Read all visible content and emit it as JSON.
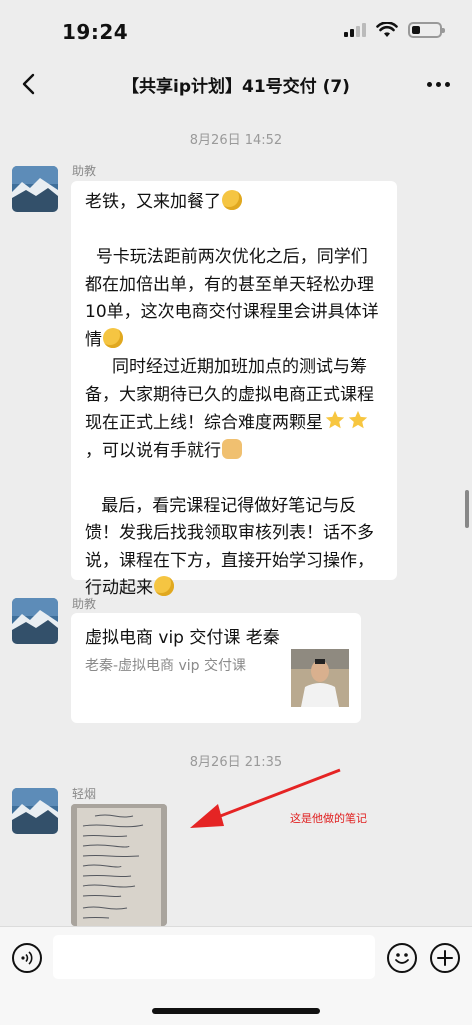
{
  "status_bar": {
    "time": "19:24"
  },
  "nav": {
    "title": "【共享ip计划】41号交付 (7)"
  },
  "messages": {
    "ts1": "8月26日 14:52",
    "m1": {
      "sender": "助教",
      "p1": "老铁，又来加餐了",
      "p2": "  号卡玩法距前两次优化之后，同学们都在加倍出单，有的甚至单天轻松办理10单，这次电商交付课程里会讲具体详情",
      "p3": "     同时经过近期加班加点的测试与筹备，大家期待已久的虚拟电商正式课程现在正式上线！综合难度两颗星",
      "p3_tail": "，可以说有手就行",
      "p4": "   最后，看完课程记得做好笔记与反馈！发我后找我领取审核列表！话不多说，课程在下方，直接开始学习操作，行动起来"
    },
    "m2": {
      "sender": "助教",
      "link_title": "虚拟电商 vip 交付课 老秦",
      "link_desc": "老秦-虚拟电商 vip 交付课"
    },
    "ts2": "8月26日 21:35",
    "m3": {
      "sender": "轻烟"
    },
    "annotation": "这是他做的笔记"
  },
  "input": {
    "placeholder": ""
  }
}
